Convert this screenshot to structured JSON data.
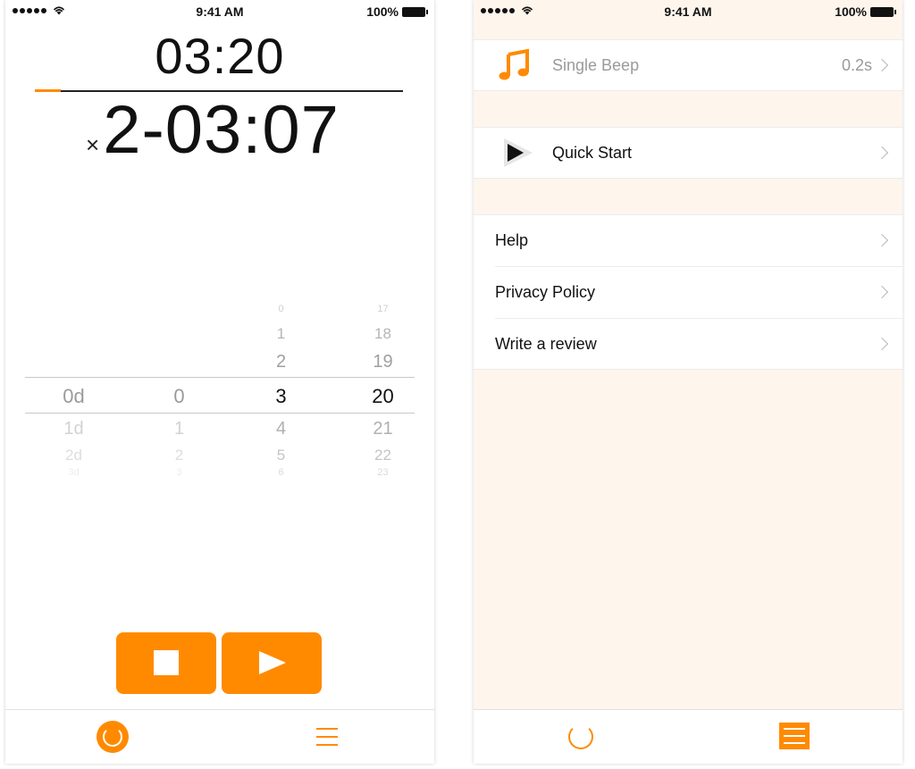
{
  "status_bar": {
    "time": "9:41 AM",
    "battery": "100%"
  },
  "timer": {
    "interval": "03:20",
    "repeat_prefix": "×",
    "remaining": "2-03:07",
    "progress_fraction": 0.07
  },
  "picker": {
    "columns": [
      {
        "rows": [
          "",
          "",
          "",
          "0d",
          "1d",
          "2d",
          "3d"
        ],
        "dim": true
      },
      {
        "rows": [
          "",
          "",
          "",
          "0",
          "1",
          "2",
          "3"
        ],
        "dim": true
      },
      {
        "rows": [
          "0",
          "1",
          "2",
          "3",
          "4",
          "5",
          "6"
        ],
        "dim": false
      },
      {
        "rows": [
          "17",
          "18",
          "19",
          "20",
          "21",
          "22",
          "23"
        ],
        "dim": false
      }
    ]
  },
  "controls": {
    "stop_icon": "stop-icon",
    "play_icon": "play-icon"
  },
  "settings": {
    "sound": {
      "icon": "music-note-icon",
      "label": "Single Beep",
      "value": "0.2s"
    },
    "quick_start": {
      "icon": "play-triangle-icon",
      "label": "Quick Start"
    },
    "links": [
      {
        "label": "Help"
      },
      {
        "label": "Privacy Policy"
      },
      {
        "label": "Write a review"
      }
    ]
  },
  "tabs": [
    {
      "icon": "timer-icon"
    },
    {
      "icon": "menu-icon"
    }
  ],
  "colors": {
    "accent": "#ff8a00",
    "settings_background": "#fef5ed"
  }
}
